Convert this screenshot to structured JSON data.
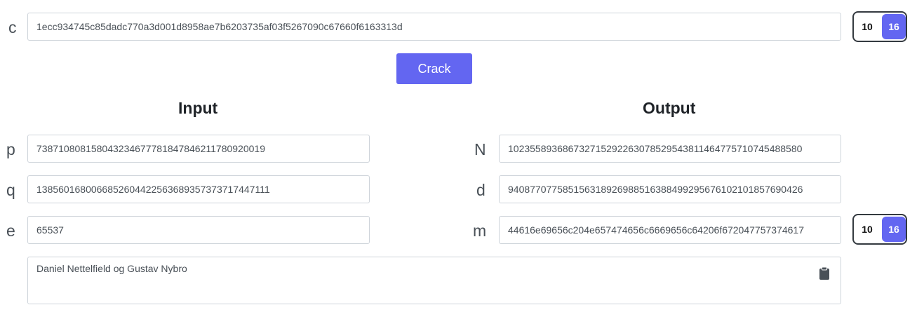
{
  "ciphertext": {
    "label": "c",
    "value": "1ecc934745c85dadc770a3d001d8958ae7b6203735af03f5267090c67660f6163313d"
  },
  "base_toggle_top": {
    "option_a": "10",
    "option_b": "16",
    "selected": "16"
  },
  "crack_button": "Crack",
  "input_heading": "Input",
  "output_heading": "Output",
  "inputs": {
    "p": {
      "label": "p",
      "value": "73871080815804323467778184784621178092001​9"
    },
    "q": {
      "label": "q",
      "value": "138560168006685260442256368935737371744711​1"
    },
    "e": {
      "label": "e",
      "value": "65537"
    }
  },
  "outputs": {
    "N": {
      "label": "N",
      "value": "1023558936867327152922630785295438114647757107454885​80"
    },
    "d": {
      "label": "d",
      "value": "9408770775851563189269885163884992956761021018576904​26"
    },
    "m": {
      "label": "m",
      "value": "44616e69656c204e657474656c6669656c64206f6720477573746​17"
    }
  },
  "base_toggle_bottom": {
    "option_a": "10",
    "option_b": "16",
    "selected": "16"
  },
  "notes_text": "Daniel Nettelfield og Gustav Nybro",
  "icons": {
    "clipboard": "clipboard-icon"
  },
  "colors": {
    "accent": "#6366f1",
    "border": "#ced4da",
    "toggle_border": "#343a40"
  }
}
